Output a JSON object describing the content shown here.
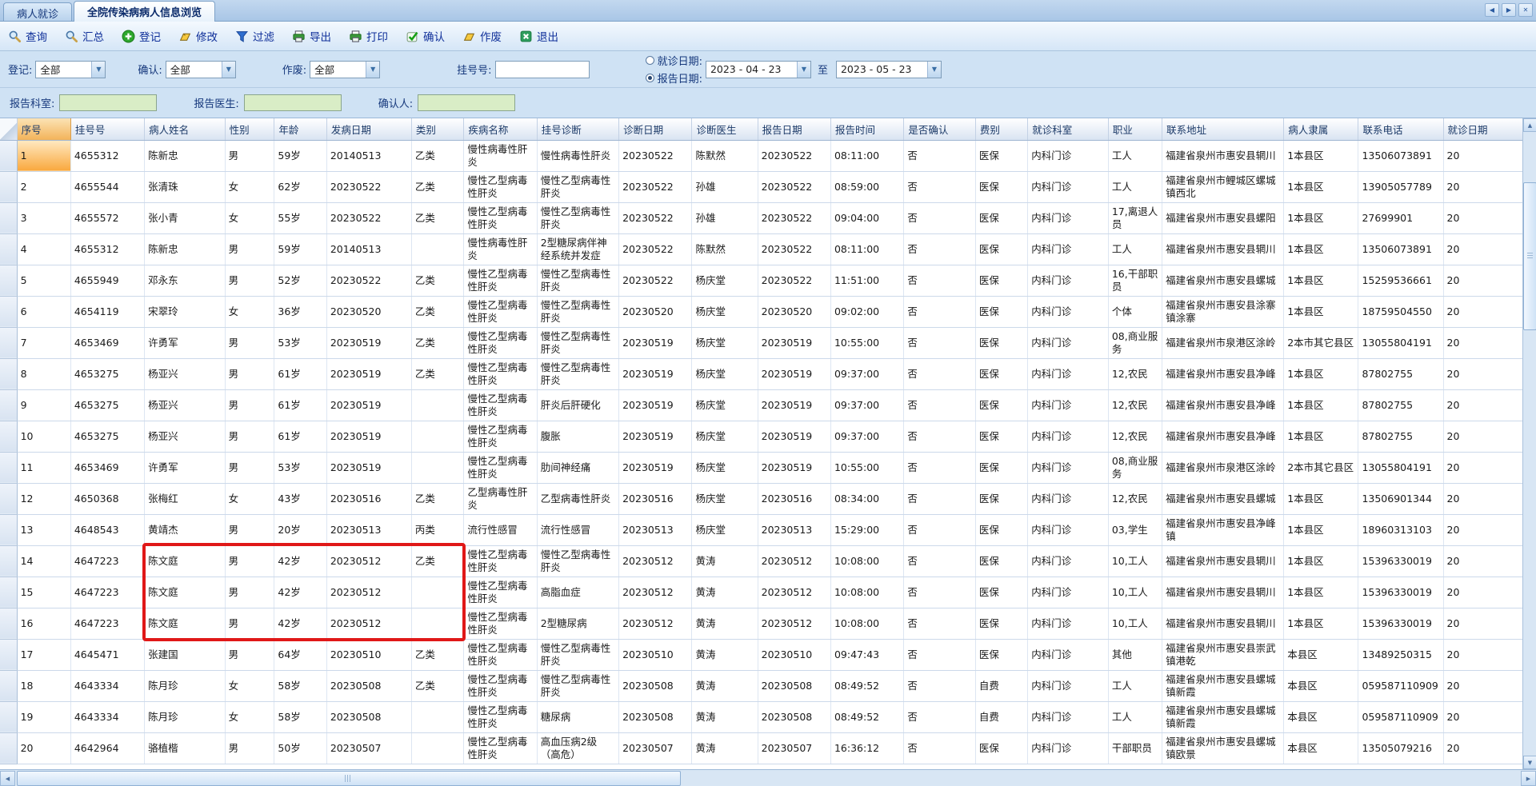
{
  "window": {
    "tabs": [
      {
        "name": "patient-visit",
        "label": "病人就诊",
        "active": false
      },
      {
        "name": "infectious-browse",
        "label": "全院传染病病人信息浏览",
        "active": true
      }
    ],
    "controls": {
      "scroll_left": "◀",
      "scroll_right": "▶",
      "close": "✕"
    }
  },
  "toolbar": {
    "buttons": [
      {
        "name": "query",
        "label": "查询",
        "icon": "magnifier-icon"
      },
      {
        "name": "summary",
        "label": "汇总",
        "icon": "magnifier-icon"
      },
      {
        "name": "register",
        "label": "登记",
        "icon": "add-circle-icon"
      },
      {
        "name": "modify",
        "label": "修改",
        "icon": "edit-icon"
      },
      {
        "name": "filter",
        "label": "过滤",
        "icon": "funnel-icon"
      },
      {
        "name": "export",
        "label": "导出",
        "icon": "printer-icon"
      },
      {
        "name": "print",
        "label": "打印",
        "icon": "printer-icon"
      },
      {
        "name": "confirm",
        "label": "确认",
        "icon": "check-icon"
      },
      {
        "name": "void",
        "label": "作废",
        "icon": "void-icon"
      },
      {
        "name": "exit",
        "label": "退出",
        "icon": "exit-icon"
      }
    ]
  },
  "filters": {
    "registration": {
      "label": "登记:",
      "value": "全部"
    },
    "confirm": {
      "label": "确认:",
      "value": "全部"
    },
    "void": {
      "label": "作废:",
      "value": "全部"
    },
    "reg_no": {
      "label": "挂号号:",
      "value": ""
    },
    "date_mode": {
      "options": [
        {
          "label": "就诊日期:",
          "selected": false
        },
        {
          "label": "报告日期:",
          "selected": true
        }
      ]
    },
    "date_from": "2023 - 04 - 23",
    "date_to_label": "至",
    "date_to": "2023 - 05 - 23",
    "report_dept": {
      "label": "报告科室:",
      "value": ""
    },
    "report_doctor": {
      "label": "报告医生:",
      "value": ""
    },
    "confirmer": {
      "label": "确认人:",
      "value": ""
    }
  },
  "table": {
    "columns": [
      "序号",
      "挂号号",
      "病人姓名",
      "性别",
      "年龄",
      "发病日期",
      "类别",
      "疾病名称",
      "挂号诊断",
      "诊断日期",
      "诊断医生",
      "报告日期",
      "报告时间",
      "是否确认",
      "费别",
      "就诊科室",
      "职业",
      "联系地址",
      "病人隶属",
      "联系电话",
      "就诊日期"
    ],
    "last_column_clipped": true,
    "selected_cell": {
      "row": 1,
      "column": "序号"
    },
    "rows": [
      [
        "1",
        "4655312",
        "陈新忠",
        "男",
        "59岁",
        "20140513",
        "乙类",
        "慢性病毒性肝炎",
        "慢性病毒性肝炎",
        "20230522",
        "陈默然",
        "20230522",
        "08:11:00",
        "否",
        "医保",
        "内科门诊",
        "工人",
        "福建省泉州市惠安县辋川",
        "1本县区",
        "13506073891",
        "20"
      ],
      [
        "2",
        "4655544",
        "张清珠",
        "女",
        "62岁",
        "20230522",
        "乙类",
        "慢性乙型病毒性肝炎",
        "慢性乙型病毒性肝炎",
        "20230522",
        "孙雄",
        "20230522",
        "08:59:00",
        "否",
        "医保",
        "内科门诊",
        "工人",
        "福建省泉州市鲤城区螺城镇西北",
        "1本县区",
        "13905057789",
        "20"
      ],
      [
        "3",
        "4655572",
        "张小青",
        "女",
        "55岁",
        "20230522",
        "乙类",
        "慢性乙型病毒性肝炎",
        "慢性乙型病毒性肝炎",
        "20230522",
        "孙雄",
        "20230522",
        "09:04:00",
        "否",
        "医保",
        "内科门诊",
        "17,离退人员",
        "福建省泉州市惠安县螺阳",
        "1本县区",
        "27699901",
        "20"
      ],
      [
        "4",
        "4655312",
        "陈新忠",
        "男",
        "59岁",
        "20140513",
        "",
        "慢性病毒性肝炎",
        "2型糖尿病伴神经系统并发症",
        "20230522",
        "陈默然",
        "20230522",
        "08:11:00",
        "否",
        "医保",
        "内科门诊",
        "工人",
        "福建省泉州市惠安县辋川",
        "1本县区",
        "13506073891",
        "20"
      ],
      [
        "5",
        "4655949",
        "邓永东",
        "男",
        "52岁",
        "20230522",
        "乙类",
        "慢性乙型病毒性肝炎",
        "慢性乙型病毒性肝炎",
        "20230522",
        "杨庆堂",
        "20230522",
        "11:51:00",
        "否",
        "医保",
        "内科门诊",
        "16,干部职员",
        "福建省泉州市惠安县螺城",
        "1本县区",
        "15259536661",
        "20"
      ],
      [
        "6",
        "4654119",
        "宋翠玲",
        "女",
        "36岁",
        "20230520",
        "乙类",
        "慢性乙型病毒性肝炎",
        "慢性乙型病毒性肝炎",
        "20230520",
        "杨庆堂",
        "20230520",
        "09:02:00",
        "否",
        "医保",
        "内科门诊",
        "个体",
        "福建省泉州市惠安县涂寨镇涂寨",
        "1本县区",
        "18759504550",
        "20"
      ],
      [
        "7",
        "4653469",
        "许勇军",
        "男",
        "53岁",
        "20230519",
        "乙类",
        "慢性乙型病毒性肝炎",
        "慢性乙型病毒性肝炎",
        "20230519",
        "杨庆堂",
        "20230519",
        "10:55:00",
        "否",
        "医保",
        "内科门诊",
        "08,商业服务",
        "福建省泉州市泉港区涂岭",
        "2本市其它县区",
        "13055804191",
        "20"
      ],
      [
        "8",
        "4653275",
        "杨亚兴",
        "男",
        "61岁",
        "20230519",
        "乙类",
        "慢性乙型病毒性肝炎",
        "慢性乙型病毒性肝炎",
        "20230519",
        "杨庆堂",
        "20230519",
        "09:37:00",
        "否",
        "医保",
        "内科门诊",
        "12,农民",
        "福建省泉州市惠安县净峰",
        "1本县区",
        "87802755",
        "20"
      ],
      [
        "9",
        "4653275",
        "杨亚兴",
        "男",
        "61岁",
        "20230519",
        "",
        "慢性乙型病毒性肝炎",
        "肝炎后肝硬化",
        "20230519",
        "杨庆堂",
        "20230519",
        "09:37:00",
        "否",
        "医保",
        "内科门诊",
        "12,农民",
        "福建省泉州市惠安县净峰",
        "1本县区",
        "87802755",
        "20"
      ],
      [
        "10",
        "4653275",
        "杨亚兴",
        "男",
        "61岁",
        "20230519",
        "",
        "慢性乙型病毒性肝炎",
        "腹胀",
        "20230519",
        "杨庆堂",
        "20230519",
        "09:37:00",
        "否",
        "医保",
        "内科门诊",
        "12,农民",
        "福建省泉州市惠安县净峰",
        "1本县区",
        "87802755",
        "20"
      ],
      [
        "11",
        "4653469",
        "许勇军",
        "男",
        "53岁",
        "20230519",
        "",
        "慢性乙型病毒性肝炎",
        "肋间神经痛",
        "20230519",
        "杨庆堂",
        "20230519",
        "10:55:00",
        "否",
        "医保",
        "内科门诊",
        "08,商业服务",
        "福建省泉州市泉港区涂岭",
        "2本市其它县区",
        "13055804191",
        "20"
      ],
      [
        "12",
        "4650368",
        "张梅红",
        "女",
        "43岁",
        "20230516",
        "乙类",
        "乙型病毒性肝炎",
        "乙型病毒性肝炎",
        "20230516",
        "杨庆堂",
        "20230516",
        "08:34:00",
        "否",
        "医保",
        "内科门诊",
        "12,农民",
        "福建省泉州市惠安县螺城",
        "1本县区",
        "13506901344",
        "20"
      ],
      [
        "13",
        "4648543",
        "黄靖杰",
        "男",
        "20岁",
        "20230513",
        "丙类",
        "流行性感冒",
        "流行性感冒",
        "20230513",
        "杨庆堂",
        "20230513",
        "15:29:00",
        "否",
        "医保",
        "内科门诊",
        "03,学生",
        "福建省泉州市惠安县净峰镇",
        "1本县区",
        "18960313103",
        "20"
      ],
      [
        "14",
        "4647223",
        "陈文庭",
        "男",
        "42岁",
        "20230512",
        "乙类",
        "慢性乙型病毒性肝炎",
        "慢性乙型病毒性肝炎",
        "20230512",
        "黄涛",
        "20230512",
        "10:08:00",
        "否",
        "医保",
        "内科门诊",
        "10,工人",
        "福建省泉州市惠安县辋川",
        "1本县区",
        "15396330019",
        "20"
      ],
      [
        "15",
        "4647223",
        "陈文庭",
        "男",
        "42岁",
        "20230512",
        "",
        "慢性乙型病毒性肝炎",
        "高脂血症",
        "20230512",
        "黄涛",
        "20230512",
        "10:08:00",
        "否",
        "医保",
        "内科门诊",
        "10,工人",
        "福建省泉州市惠安县辋川",
        "1本县区",
        "15396330019",
        "20"
      ],
      [
        "16",
        "4647223",
        "陈文庭",
        "男",
        "42岁",
        "20230512",
        "",
        "慢性乙型病毒性肝炎",
        "2型糖尿病",
        "20230512",
        "黄涛",
        "20230512",
        "10:08:00",
        "否",
        "医保",
        "内科门诊",
        "10,工人",
        "福建省泉州市惠安县辋川",
        "1本县区",
        "15396330019",
        "20"
      ],
      [
        "17",
        "4645471",
        "张建国",
        "男",
        "64岁",
        "20230510",
        "乙类",
        "慢性乙型病毒性肝炎",
        "慢性乙型病毒性肝炎",
        "20230510",
        "黄涛",
        "20230510",
        "09:47:43",
        "否",
        "医保",
        "内科门诊",
        "其他",
        "福建省泉州市惠安县崇武镇港乾",
        "本县区",
        "13489250315",
        "20"
      ],
      [
        "18",
        "4643334",
        "陈月珍",
        "女",
        "58岁",
        "20230508",
        "乙类",
        "慢性乙型病毒性肝炎",
        "慢性乙型病毒性肝炎",
        "20230508",
        "黄涛",
        "20230508",
        "08:49:52",
        "否",
        "自费",
        "内科门诊",
        "工人",
        "福建省泉州市惠安县螺城镇新霞",
        "本县区",
        "059587110909",
        "20"
      ],
      [
        "19",
        "4643334",
        "陈月珍",
        "女",
        "58岁",
        "20230508",
        "",
        "慢性乙型病毒性肝炎",
        "糖尿病",
        "20230508",
        "黄涛",
        "20230508",
        "08:49:52",
        "否",
        "自费",
        "内科门诊",
        "工人",
        "福建省泉州市惠安县螺城镇新霞",
        "本县区",
        "059587110909",
        "20"
      ],
      [
        "20",
        "4642964",
        "骆植楷",
        "男",
        "50岁",
        "20230507",
        "",
        "慢性乙型病毒性肝炎",
        "高血压病2级（高危）",
        "20230507",
        "黄涛",
        "20230507",
        "16:36:12",
        "否",
        "医保",
        "内科门诊",
        "干部职员",
        "福建省泉州市惠安县螺城镇欧景",
        "本县区",
        "13505079216",
        "20"
      ]
    ]
  },
  "annotation": {
    "type": "red-highlight-box",
    "color": "#e01818",
    "row_start": 14,
    "row_end": 16,
    "col_start": "病人姓名",
    "col_end": "类别"
  }
}
